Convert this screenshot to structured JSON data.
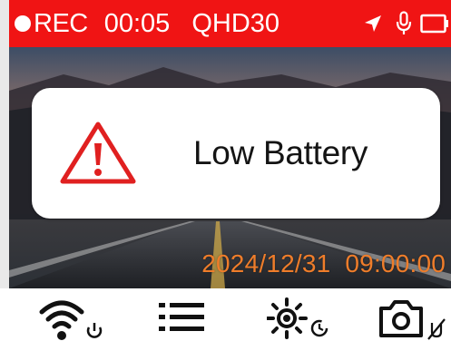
{
  "status_bar": {
    "rec_label": "REC",
    "elapsed": "00:05",
    "quality": "QHD30",
    "icons": [
      "location-arrow-icon",
      "microphone-icon",
      "battery-empty-icon"
    ],
    "background": "#f01414"
  },
  "dialog": {
    "icon": "warning-triangle-icon",
    "message": "Low Battery",
    "icon_color": "#e02020"
  },
  "overlay": {
    "date": "2024/12/31",
    "time": "09:00:00",
    "color": "#ef7d2a"
  },
  "toolbar": {
    "items": [
      {
        "icon": "wifi-power-icon"
      },
      {
        "icon": "menu-list-icon"
      },
      {
        "icon": "brightness-timer-icon"
      },
      {
        "icon": "camera-mute-icon"
      }
    ]
  }
}
